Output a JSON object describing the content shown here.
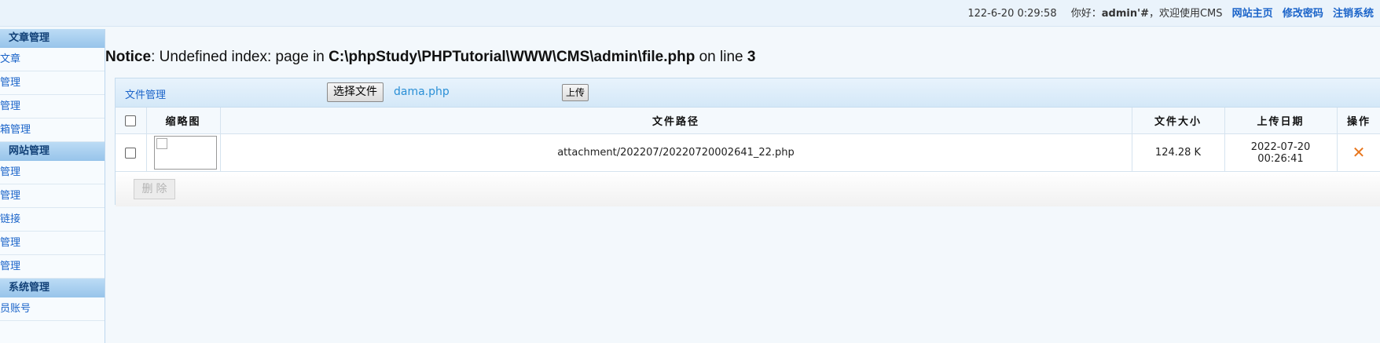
{
  "topbar": {
    "datetime": "122-6-20 0:29:58",
    "greeting_prefix": "你好：",
    "username": "admin'#",
    "greeting_suffix": "，欢迎使用CMS",
    "links": [
      "网站主页",
      "修改密码",
      "注销系统"
    ]
  },
  "sidebar": {
    "sections": [
      {
        "title": "文章管理",
        "items": [
          "加文章",
          "章管理",
          "目管理",
          "意箱管理"
        ]
      },
      {
        "title": "网站管理",
        "items": [
          "告管理",
          "言管理",
          "情链接",
          "件管理",
          "户管理"
        ]
      },
      {
        "title": "系统管理",
        "items": [
          "理员账号"
        ]
      }
    ]
  },
  "notice": {
    "label": "Notice",
    "message_before": ": Undefined index: page in ",
    "path": "C:\\phpStudy\\PHPTutorial\\WWW\\CMS\\admin\\file.php",
    "message_mid": " on line ",
    "line": "3"
  },
  "file_panel": {
    "title": "文件管理",
    "choose_button": "选择文件",
    "selected_file": "dama.php",
    "upload_button": "上传",
    "columns": [
      "",
      "缩略图",
      "文件路径",
      "文件大小",
      "上传日期",
      "操作"
    ],
    "rows": [
      {
        "path": "attachment/202207/20220720002641_22.php",
        "size": "124.28 K",
        "date": "2022-07-20",
        "time": "00:26:41",
        "action_icon": "delete-x-icon"
      }
    ],
    "delete_button": "删除",
    "colors": {
      "accent": "#1b64c9",
      "delete_icon": "#e8761d"
    }
  }
}
